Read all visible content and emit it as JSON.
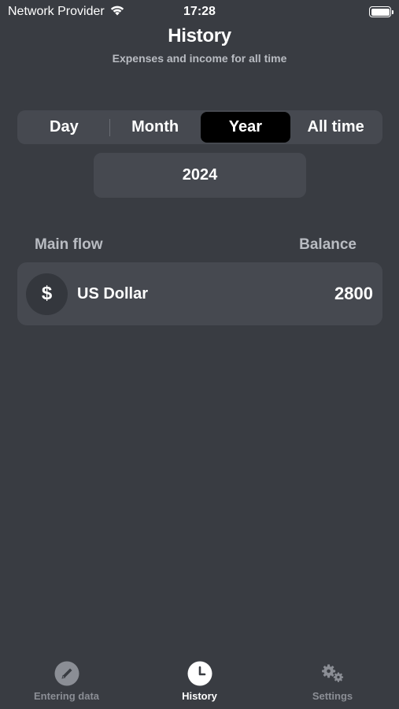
{
  "status_bar": {
    "carrier": "Network Provider",
    "time": "17:28"
  },
  "header": {
    "title": "History",
    "subtitle": "Expenses and income for all time"
  },
  "period_selector": {
    "segments": [
      "Day",
      "Month",
      "Year",
      "All time"
    ],
    "selected": "Year"
  },
  "year_selector": {
    "value": "2024"
  },
  "section": {
    "left_label": "Main flow",
    "right_label": "Balance"
  },
  "currencies": [
    {
      "symbol": "$",
      "name": "US Dollar",
      "balance": "2800"
    }
  ],
  "tab_bar": {
    "tabs": [
      {
        "label": "Entering data",
        "icon": "pencil-icon",
        "active": false
      },
      {
        "label": "History",
        "icon": "clock-icon",
        "active": true
      },
      {
        "label": "Settings",
        "icon": "gears-icon",
        "active": false
      }
    ]
  },
  "colors": {
    "background": "#393c42",
    "card": "#464950",
    "selected_segment": "#000000",
    "muted_text": "#b9bcc2",
    "inactive_tab": "#8b8e95"
  }
}
